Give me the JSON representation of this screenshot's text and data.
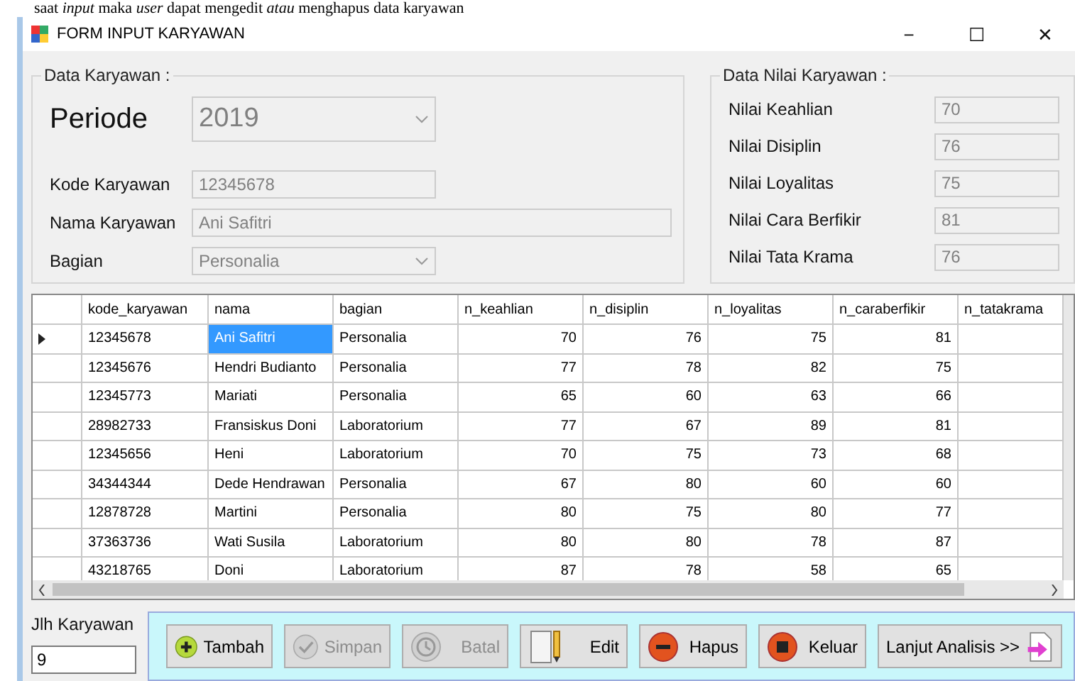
{
  "document_text": "saat *input* maka *user* dapat mengedit *atau* menghapus data karyawan",
  "window": {
    "title": "FORM INPUT KARYAWAN",
    "controls": [
      "−",
      "☐",
      "✕"
    ]
  },
  "data_karyawan": {
    "legend": "Data Karyawan :",
    "periode": {
      "label": "Periode",
      "value": "2019"
    },
    "fields": [
      {
        "label": "Kode Karyawan",
        "value": "12345678",
        "kind": "text",
        "wide": false
      },
      {
        "label": "Nama Karyawan",
        "value": "Ani Safitri",
        "kind": "text",
        "wide": true
      },
      {
        "label": "Bagian",
        "value": "Personalia",
        "kind": "combo",
        "wide": false
      }
    ]
  },
  "data_nilai": {
    "legend": "Data Nilai Karyawan :",
    "fields": [
      {
        "label": "Nilai Keahlian",
        "value": "70"
      },
      {
        "label": "Nilai Disiplin",
        "value": "76"
      },
      {
        "label": "Nilai Loyalitas",
        "value": "75"
      },
      {
        "label": "Nilai Cara Berfikir",
        "value": "81"
      },
      {
        "label": "Nilai Tata Krama",
        "value": "76"
      }
    ]
  },
  "table": {
    "columns": [
      "kode_karyawan",
      "nama",
      "bagian",
      "n_keahlian",
      "n_disiplin",
      "n_loyalitas",
      "n_caraberfikir",
      "n_tatakrama"
    ],
    "rows": [
      {
        "current": true,
        "cells": [
          "12345678",
          "Ani Safitri",
          "Personalia",
          "70",
          "76",
          "75",
          "81"
        ]
      },
      {
        "current": false,
        "cells": [
          "12345676",
          "Hendri Budianto",
          "Personalia",
          "77",
          "78",
          "82",
          "75"
        ]
      },
      {
        "current": false,
        "cells": [
          "12345773",
          "Mariati",
          "Personalia",
          "65",
          "60",
          "63",
          "66"
        ]
      },
      {
        "current": false,
        "cells": [
          "28982733",
          "Fransiskus Doni",
          "Laboratorium",
          "77",
          "67",
          "89",
          "81"
        ]
      },
      {
        "current": false,
        "cells": [
          "12345656",
          "Heni",
          "Laboratorium",
          "70",
          "75",
          "73",
          "68"
        ]
      },
      {
        "current": false,
        "cells": [
          "34344344",
          "Dede Hendrawan",
          "Personalia",
          "67",
          "80",
          "60",
          "60"
        ]
      },
      {
        "current": false,
        "cells": [
          "12878728",
          "Martini",
          "Personalia",
          "80",
          "75",
          "80",
          "77"
        ]
      },
      {
        "current": false,
        "cells": [
          "37363736",
          "Wati Susila",
          "Laboratorium",
          "80",
          "80",
          "78",
          "87"
        ]
      },
      {
        "current": false,
        "cells": [
          "43218765",
          "Doni",
          "Laboratorium",
          "87",
          "78",
          "58",
          "65"
        ]
      }
    ]
  },
  "count": {
    "label": "Jlh Karyawan",
    "value": "9"
  },
  "buttons": [
    {
      "label": "Tambah",
      "kind": "plus",
      "disabled": false
    },
    {
      "label": "Simpan",
      "kind": "check",
      "disabled": true
    },
    {
      "label": "Batal",
      "kind": "history",
      "disabled": true
    },
    {
      "label": "Edit",
      "kind": "pencil",
      "disabled": false
    },
    {
      "label": "Hapus",
      "kind": "minus",
      "disabled": false
    },
    {
      "label": "Keluar",
      "kind": "stop",
      "disabled": false
    },
    {
      "label": "Lanjut Analisis >>",
      "kind": "next",
      "disabled": false
    }
  ]
}
